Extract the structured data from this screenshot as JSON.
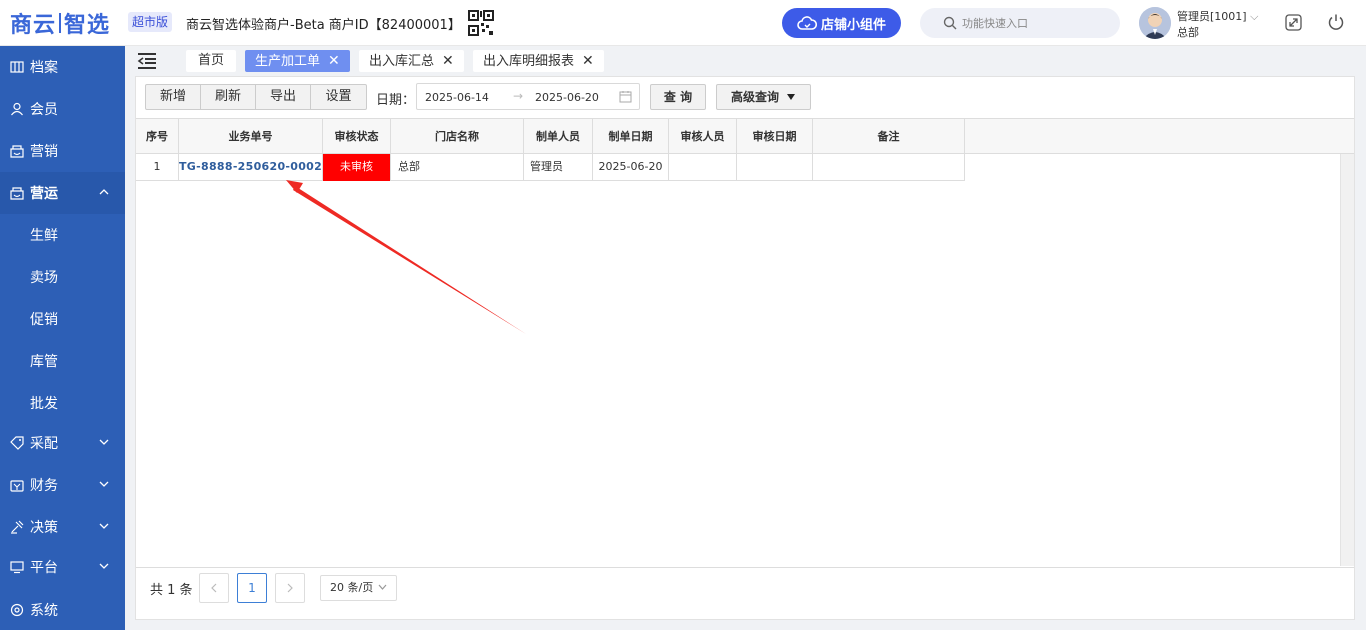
{
  "header": {
    "logo_part1": "商云",
    "logo_part2": "智选",
    "store_type": "超市版",
    "merchant_text": "商云智选体验商户-Beta  商户ID【82400001】",
    "widget_button": "店铺小组件",
    "search_placeholder": "功能快速入口",
    "user_name": "管理员[1001]",
    "user_org": "总部"
  },
  "sidebar": {
    "items": [
      {
        "label": "档案",
        "icon": "archive-icon"
      },
      {
        "label": "会员",
        "icon": "user-icon"
      },
      {
        "label": "营销",
        "icon": "shop-icon"
      },
      {
        "label": "营运",
        "icon": "shop-icon",
        "expanded": true
      },
      {
        "label": "采配",
        "icon": "tag-icon"
      },
      {
        "label": "财务",
        "icon": "wallet-icon"
      },
      {
        "label": "决策",
        "icon": "decision-icon"
      },
      {
        "label": "平台",
        "icon": "monitor-icon"
      },
      {
        "label": "系统",
        "icon": "settings-icon"
      }
    ],
    "sub_items": [
      "生鲜",
      "卖场",
      "促销",
      "库管",
      "批发"
    ]
  },
  "tabs": [
    {
      "label": "首页",
      "closable": false,
      "active": false
    },
    {
      "label": "生产加工单",
      "closable": true,
      "active": true
    },
    {
      "label": "出入库汇总",
      "closable": true,
      "active": false
    },
    {
      "label": "出入库明细报表",
      "closable": true,
      "active": false
    }
  ],
  "toolbar": {
    "buttons": [
      "新增",
      "刷新",
      "导出",
      "设置"
    ],
    "date_label": "日期：",
    "date_from": "2025-06-14",
    "date_to": "2025-06-20",
    "query_button": "查 询",
    "advanced_button": "高级查询"
  },
  "table": {
    "columns": [
      "序号",
      "业务单号",
      "审核状态",
      "门店名称",
      "制单人员",
      "制单日期",
      "审核人员",
      "审核日期",
      "备注"
    ],
    "rows": [
      {
        "index": "1",
        "order_no": "TG-8888-250620-0002",
        "status": "未审核",
        "store": "总部",
        "creator": "管理员",
        "create_date": "2025-06-20",
        "auditor": "",
        "audit_date": "",
        "remark": ""
      }
    ]
  },
  "pager": {
    "total": "共 1 条",
    "current_page": "1",
    "page_size": "20 条/页"
  },
  "colors": {
    "primary": "#3d5be8",
    "sidebar": "#2d5fb6",
    "status_unreviewed": "#ff0000",
    "annotation_arrow": "#ee2a24"
  }
}
